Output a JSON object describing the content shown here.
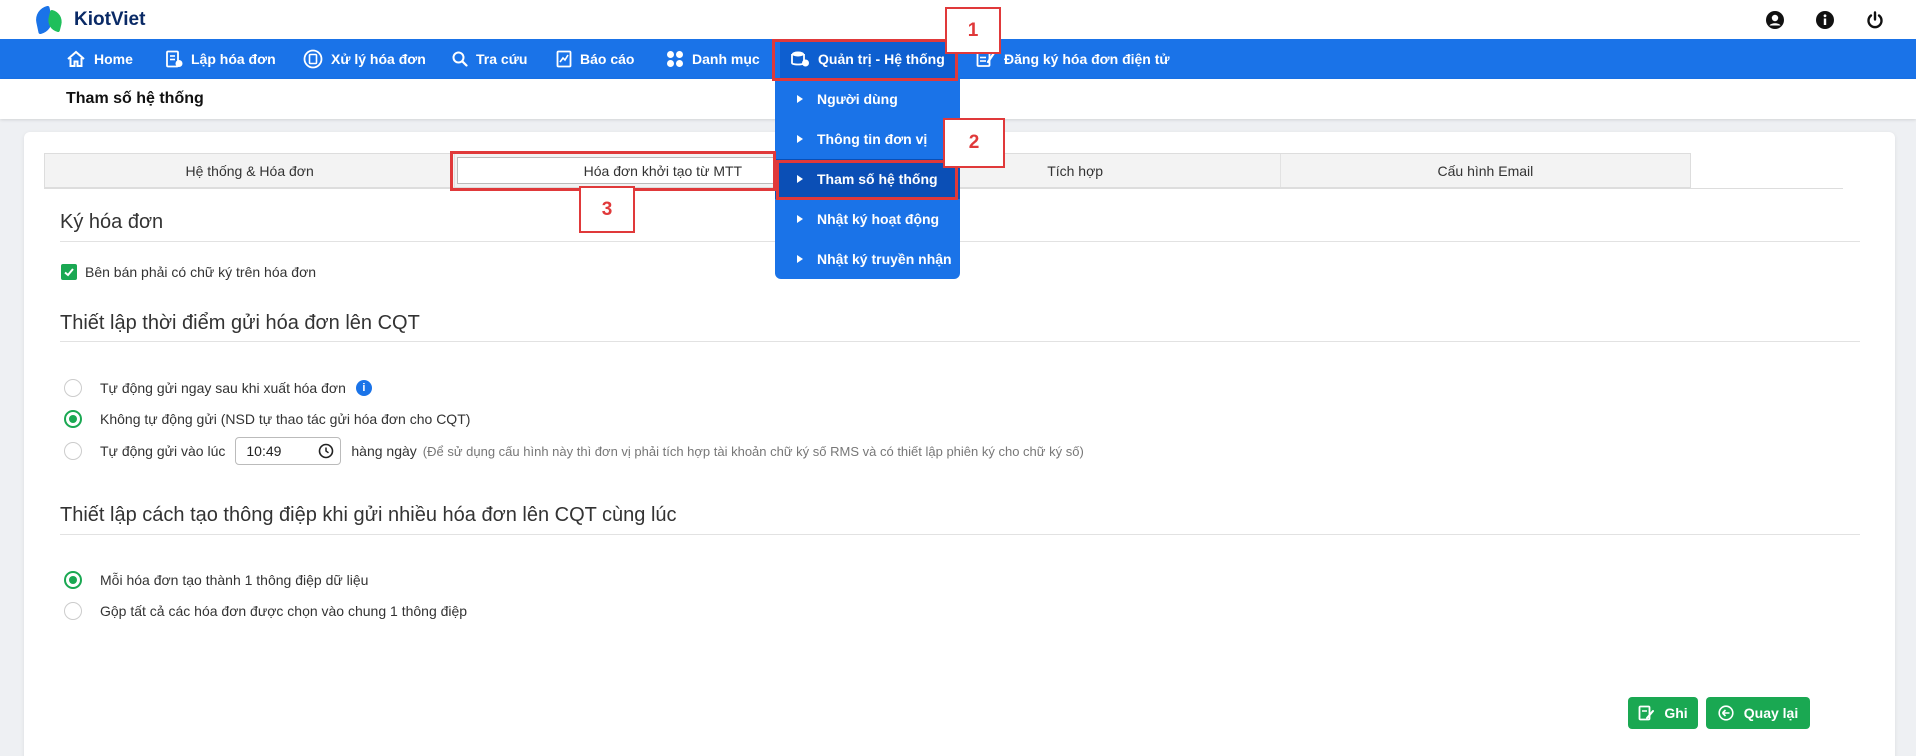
{
  "app": {
    "logo_text": "KiotViet"
  },
  "header_icons": [
    "user-icon",
    "info-icon",
    "power-icon"
  ],
  "nav": {
    "items": [
      {
        "label": "Home",
        "icon": "home-icon"
      },
      {
        "label": "Lập hóa đơn",
        "icon": "invoice-icon"
      },
      {
        "label": "Xử lý hóa đơn",
        "icon": "process-icon"
      },
      {
        "label": "Tra cứu",
        "icon": "search-icon"
      },
      {
        "label": "Báo cáo",
        "icon": "report-icon"
      },
      {
        "label": "Danh mục",
        "icon": "grid-icon"
      },
      {
        "label": "Quản trị - Hệ thống",
        "icon": "admin-icon"
      },
      {
        "label": "Đăng ký hóa đơn điện tử",
        "icon": "register-icon"
      }
    ]
  },
  "dropdown": {
    "items": [
      {
        "label": "Người dùng"
      },
      {
        "label": "Thông tin đơn vị"
      },
      {
        "label": "Tham số hệ thống"
      },
      {
        "label": "Nhật ký hoạt động"
      },
      {
        "label": "Nhật ký truyền nhận"
      }
    ]
  },
  "page": {
    "title": "Tham số hệ thống"
  },
  "tabs": [
    {
      "label": "Hệ thống & Hóa đơn"
    },
    {
      "label": "Hóa đơn khởi tạo từ MTT"
    },
    {
      "label": "Tích hợp"
    },
    {
      "label": "Cấu hình Email"
    }
  ],
  "sections": {
    "sign": {
      "title": "Ký hóa đơn",
      "checkbox_label": "Bên bán phải có chữ ký trên hóa đơn",
      "checked": true
    },
    "send_time": {
      "title": "Thiết lập thời điểm gửi hóa đơn lên CQT",
      "options": [
        {
          "label": "Tự động gửi ngay sau khi xuất hóa đơn",
          "selected": false
        },
        {
          "label": "Không tự động gửi (NSD tự thao tác gửi hóa đơn cho CQT)",
          "selected": true
        },
        {
          "label": "Tự động gửi vào lúc",
          "selected": false
        }
      ],
      "time_value": "10:49",
      "daily_label": "hàng ngày",
      "hint": "(Để sử dụng cấu hình này thì đơn vị phải tích hợp tài khoản chữ ký số RMS và có thiết lập phiên ký cho chữ ký số)"
    },
    "message": {
      "title": "Thiết lập cách tạo thông điệp khi gửi nhiều hóa đơn lên CQT cùng lúc",
      "options": [
        {
          "label": "Mỗi hóa đơn tạo thành 1 thông điệp dữ liệu",
          "selected": true
        },
        {
          "label": "Gộp tất cả các hóa đơn được chọn vào chung 1 thông điệp",
          "selected": false
        }
      ]
    }
  },
  "buttons": {
    "save": "Ghi",
    "back": "Quay lại"
  },
  "markers": [
    "1",
    "2",
    "3"
  ],
  "colors": {
    "primary": "#1a73e8",
    "success": "#1aa852",
    "marker": "#e0393a"
  }
}
